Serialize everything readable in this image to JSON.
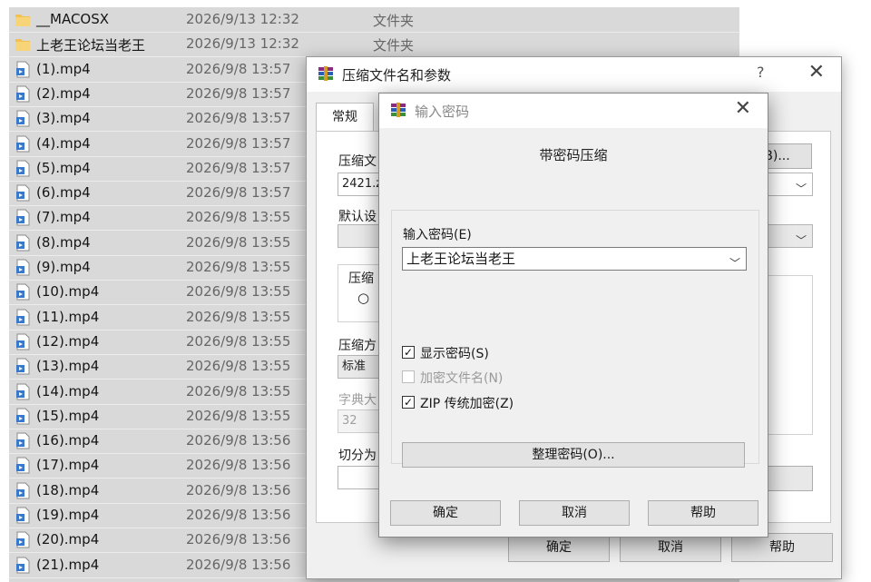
{
  "files": [
    {
      "name": "__MACOSX",
      "date": "2026/9/13 12:32",
      "type": "文件夹",
      "kind": "folder"
    },
    {
      "name": "上老王论坛当老王",
      "date": "2026/9/13 12:32",
      "type": "文件夹",
      "kind": "folder"
    },
    {
      "name": "(1).mp4",
      "date": "2026/9/8 13:57",
      "type": "",
      "kind": "video"
    },
    {
      "name": "(2).mp4",
      "date": "2026/9/8 13:57",
      "type": "",
      "kind": "video"
    },
    {
      "name": "(3).mp4",
      "date": "2026/9/8 13:57",
      "type": "",
      "kind": "video"
    },
    {
      "name": "(4).mp4",
      "date": "2026/9/8 13:57",
      "type": "",
      "kind": "video"
    },
    {
      "name": "(5).mp4",
      "date": "2026/9/8 13:57",
      "type": "",
      "kind": "video"
    },
    {
      "name": "(6).mp4",
      "date": "2026/9/8 13:57",
      "type": "",
      "kind": "video"
    },
    {
      "name": "(7).mp4",
      "date": "2026/9/8 13:55",
      "type": "",
      "kind": "video"
    },
    {
      "name": "(8).mp4",
      "date": "2026/9/8 13:55",
      "type": "",
      "kind": "video"
    },
    {
      "name": "(9).mp4",
      "date": "2026/9/8 13:55",
      "type": "",
      "kind": "video"
    },
    {
      "name": "(10).mp4",
      "date": "2026/9/8 13:55",
      "type": "",
      "kind": "video"
    },
    {
      "name": "(11).mp4",
      "date": "2026/9/8 13:55",
      "type": "",
      "kind": "video"
    },
    {
      "name": "(12).mp4",
      "date": "2026/9/8 13:55",
      "type": "",
      "kind": "video"
    },
    {
      "name": "(13).mp4",
      "date": "2026/9/8 13:55",
      "type": "",
      "kind": "video"
    },
    {
      "name": "(14).mp4",
      "date": "2026/9/8 13:55",
      "type": "",
      "kind": "video"
    },
    {
      "name": "(15).mp4",
      "date": "2026/9/8 13:55",
      "type": "",
      "kind": "video"
    },
    {
      "name": "(16).mp4",
      "date": "2026/9/8 13:56",
      "type": "",
      "kind": "video"
    },
    {
      "name": "(17).mp4",
      "date": "2026/9/8 13:56",
      "type": "",
      "kind": "video"
    },
    {
      "name": "(18).mp4",
      "date": "2026/9/8 13:56",
      "type": "",
      "kind": "video"
    },
    {
      "name": "(19).mp4",
      "date": "2026/9/8 13:56",
      "type": "",
      "kind": "video"
    },
    {
      "name": "(20).mp4",
      "date": "2026/9/8 13:56",
      "type": "",
      "kind": "video"
    },
    {
      "name": "(21).mp4",
      "date": "2026/9/8 13:56",
      "type": "",
      "kind": "video"
    }
  ],
  "back_dialog": {
    "title": "压缩文件名和参数",
    "help_glyph": "?",
    "close_glyph": "✕",
    "tab_general": "常规",
    "archive_name_label": "压缩文",
    "archive_name_value": "2421.z",
    "browse_button": "B)...",
    "default_profile_label": "默认设",
    "format_group_label": "压缩",
    "method_label": "压缩方",
    "method_value": "标准",
    "dict_label": "字典大",
    "dict_value": "32",
    "split_label": "切分为",
    "ok": "确定",
    "cancel": "取消",
    "help": "帮助"
  },
  "password_dialog": {
    "title": "输入密码",
    "close_glyph": "✕",
    "heading": "带密码压缩",
    "password_label": "输入密码(E)",
    "password_value": "上老王论坛当老王",
    "show_password": {
      "label": "显示密码(S)",
      "checked": true,
      "enabled": true
    },
    "encrypt_names": {
      "label": "加密文件名(N)",
      "checked": false,
      "enabled": false
    },
    "zip_legacy": {
      "label": "ZIP 传统加密(Z)",
      "checked": true,
      "enabled": true
    },
    "organize_button": "整理密码(O)...",
    "ok": "确定",
    "cancel": "取消",
    "help": "帮助"
  },
  "colors": {
    "folder": "#f2c14e",
    "video_icon": "#3a78c9",
    "accent": "#0b57d0"
  }
}
